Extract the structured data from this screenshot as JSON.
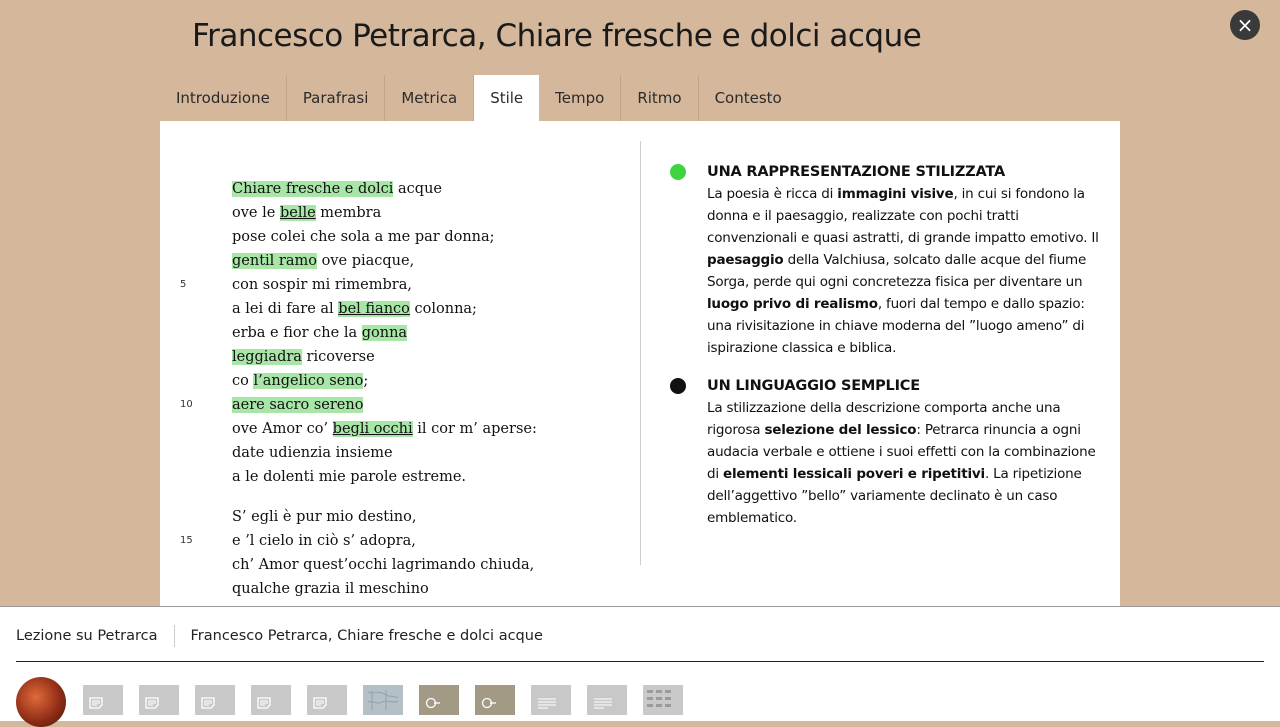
{
  "page": {
    "title": "Francesco Petrarca, Chiare fresche e dolci acque",
    "close_icon": "×"
  },
  "tabs": [
    {
      "label": "Introduzione",
      "active": false
    },
    {
      "label": "Parafrasi",
      "active": false
    },
    {
      "label": "Metrica",
      "active": false
    },
    {
      "label": "Stile",
      "active": true
    },
    {
      "label": "Tempo",
      "active": false
    },
    {
      "label": "Ritmo",
      "active": false
    },
    {
      "label": "Contesto",
      "active": false
    }
  ],
  "poem": {
    "stanzas": [
      [
        {
          "num": "",
          "segs": [
            {
              "t": "Chiare fresche e dolci",
              "h": true
            },
            {
              "t": " acque"
            }
          ]
        },
        {
          "num": "",
          "segs": [
            {
              "t": "ove le "
            },
            {
              "t": "belle",
              "h": true,
              "u": true
            },
            {
              "t": " membra"
            }
          ]
        },
        {
          "num": "",
          "segs": [
            {
              "t": "pose colei che sola a me par donna;"
            }
          ]
        },
        {
          "num": "",
          "segs": [
            {
              "t": "gentil ramo",
              "h": true
            },
            {
              "t": " ove piacque,"
            }
          ]
        },
        {
          "num": "5",
          "segs": [
            {
              "t": "con sospir mi rimembra,"
            }
          ]
        },
        {
          "num": "",
          "segs": [
            {
              "t": "a lei di fare al "
            },
            {
              "t": "bel fianco",
              "h": true,
              "u": true
            },
            {
              "t": " colonna;"
            }
          ]
        },
        {
          "num": "",
          "segs": [
            {
              "t": "erba e fior che la "
            },
            {
              "t": "gonna",
              "h": true
            }
          ]
        },
        {
          "num": "",
          "segs": [
            {
              "t": "leggiadra",
              "h": true
            },
            {
              "t": " ricoverse"
            }
          ]
        },
        {
          "num": "",
          "segs": [
            {
              "t": "co "
            },
            {
              "t": "l’angelico seno",
              "h": true
            },
            {
              "t": ";"
            }
          ]
        },
        {
          "num": "10",
          "segs": [
            {
              "t": "aere sacro sereno",
              "h": true
            }
          ]
        },
        {
          "num": "",
          "segs": [
            {
              "t": "ove Amor co’ "
            },
            {
              "t": "begli occhi",
              "h": true,
              "u": true
            },
            {
              "t": " il cor m’ aperse:"
            }
          ]
        },
        {
          "num": "",
          "segs": [
            {
              "t": "date udienzia insieme"
            }
          ]
        },
        {
          "num": "",
          "segs": [
            {
              "t": "a le dolenti mie parole estreme."
            }
          ]
        }
      ],
      [
        {
          "num": "",
          "segs": [
            {
              "t": "S’ egli è pur mio destino,"
            }
          ]
        },
        {
          "num": "15",
          "segs": [
            {
              "t": "e ’l cielo in ciò s’ adopra,"
            }
          ]
        },
        {
          "num": "",
          "segs": [
            {
              "t": "ch’ Amor quest’occhi lagrimando chiuda,"
            }
          ]
        },
        {
          "num": "",
          "segs": [
            {
              "t": "qualche grazia il meschino"
            }
          ]
        }
      ]
    ]
  },
  "notes": [
    {
      "color": "#3fd43f",
      "title": "UNA RAPPRESENTAZIONE STILIZZATA",
      "segs": [
        {
          "t": "La poesia è ricca di "
        },
        {
          "t": "immagini visive",
          "b": true
        },
        {
          "t": ", in cui si fondono la donna e il paesaggio, realizzate con pochi tratti convenzionali e quasi astratti, di grande impatto emotivo. Il "
        },
        {
          "t": "paesaggio",
          "b": true
        },
        {
          "t": " della Valchiusa, solcato dalle acque del fiume Sorga, perde qui ogni concretezza fisica per diventare un "
        },
        {
          "t": "luogo privo di realismo",
          "b": true
        },
        {
          "t": ", fuori dal tempo e dallo spazio: una rivisitazione in chiave moderna del ”luogo ameno” di ispirazione classica e biblica."
        }
      ]
    },
    {
      "color": "#111111",
      "title": "UN LINGUAGGIO SEMPLICE",
      "segs": [
        {
          "t": "La stilizzazione della descrizione comporta anche una rigorosa "
        },
        {
          "t": "selezione del lessico",
          "b": true
        },
        {
          "t": ": Petrarca rinuncia a ogni audacia verbale e ottiene i suoi effetti con la combinazione di "
        },
        {
          "t": "elementi lessicali poveri e ripetitivi",
          "b": true
        },
        {
          "t": ". La ripetizione dell’aggettivo ”bello” variamente declinato è un caso emblematico."
        }
      ]
    }
  ],
  "breadcrumb": {
    "lesson": "Lezione su Petrarca",
    "current": "Francesco Petrarca, Chiare fresche e dolci acque"
  },
  "thumbnails": [
    {
      "kind": "doc",
      "style": "grey"
    },
    {
      "kind": "doc",
      "style": "grey"
    },
    {
      "kind": "doc",
      "style": "grey"
    },
    {
      "kind": "doc",
      "style": "grey"
    },
    {
      "kind": "doc",
      "style": "grey"
    },
    {
      "kind": "map",
      "style": "map"
    },
    {
      "kind": "media",
      "style": "dark"
    },
    {
      "kind": "media",
      "style": "dark"
    },
    {
      "kind": "text",
      "style": "grey"
    },
    {
      "kind": "text",
      "style": "grey"
    },
    {
      "kind": "grid",
      "style": "grid"
    }
  ]
}
